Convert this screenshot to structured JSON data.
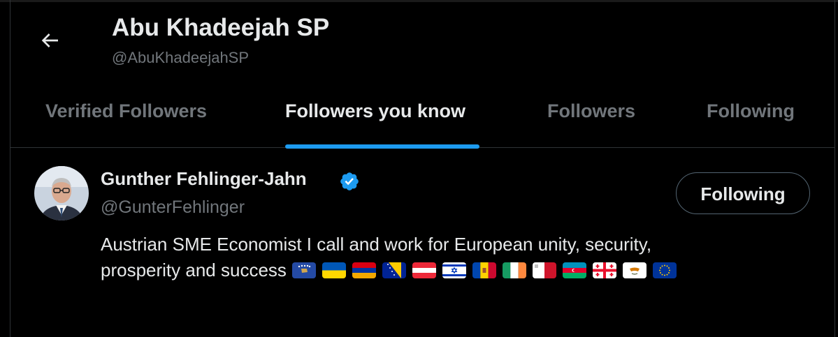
{
  "header": {
    "title": "Abu Khadeejah SP",
    "handle": "@AbuKhadeejahSP"
  },
  "tabs": [
    {
      "label": "Verified Followers",
      "active": false
    },
    {
      "label": "Followers you know",
      "active": true
    },
    {
      "label": "Followers",
      "active": false
    },
    {
      "label": "Following",
      "active": false
    }
  ],
  "user": {
    "name": "Gunther Fehlinger-Jahn",
    "handle": "@GunterFehlinger",
    "bio_line1": "Austrian SME Economist I call and work for European unity, security,",
    "bio_line2": "prosperity and success",
    "follow_label": "Following",
    "flags": [
      "kosovo",
      "ukraine",
      "armenia",
      "bosnia",
      "austria",
      "israel",
      "moldova",
      "ireland",
      "malta",
      "azerbaijan",
      "georgia",
      "cyprus",
      "eu"
    ]
  },
  "colors": {
    "accent": "#1d9bf0",
    "background": "#000000",
    "text": "#e7e9ea",
    "secondary": "#71767b"
  }
}
